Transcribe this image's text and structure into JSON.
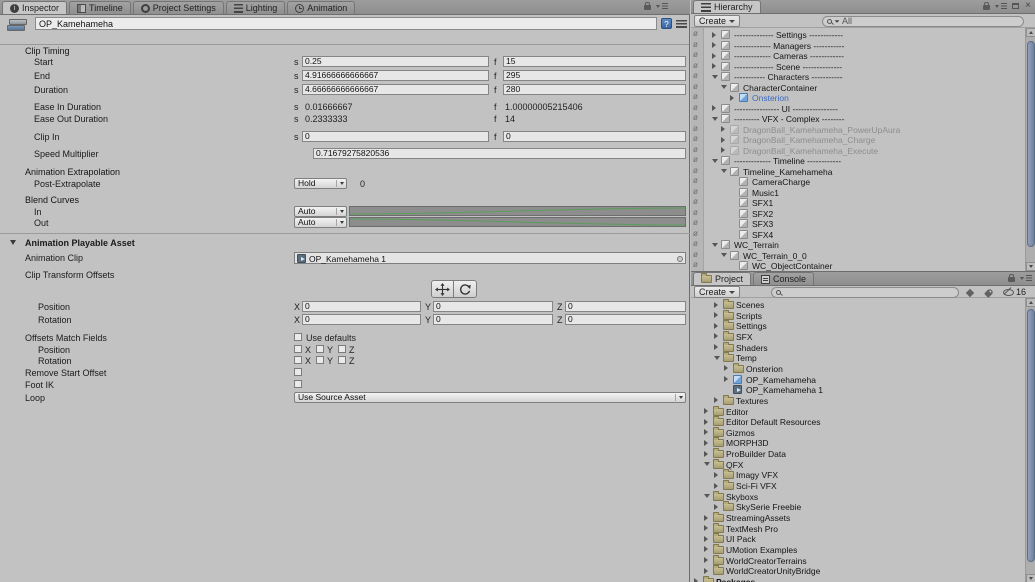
{
  "inspector": {
    "tabs": [
      {
        "label": "Inspector",
        "active": true
      },
      {
        "label": "Timeline",
        "active": false
      },
      {
        "label": "Project Settings",
        "active": false
      },
      {
        "label": "Lighting",
        "active": false
      },
      {
        "label": "Animation",
        "active": false
      }
    ],
    "header": {
      "name": "OP_Kamehameha"
    },
    "sections": {
      "clip_timing": {
        "title": "Clip Timing",
        "s_prefix": "s",
        "f_prefix": "f",
        "rows": [
          {
            "label": "Start",
            "s": "0.25",
            "f": "15",
            "boxed": true
          },
          {
            "label": "End",
            "s": "4.91666666666667",
            "f": "295",
            "boxed": true
          },
          {
            "label": "Duration",
            "s": "4.66666666666667",
            "f": "280",
            "boxed": true
          },
          {
            "label": "Ease In Duration",
            "s": "0.01666667",
            "f": "1.00000005215406",
            "boxed": false
          },
          {
            "label": "Ease Out Duration",
            "s": "0.2333333",
            "f": "14",
            "boxed": false
          },
          {
            "label": "Clip In",
            "s": "0",
            "f": "0",
            "boxed": true
          }
        ],
        "speed_multiplier_label": "Speed Multiplier",
        "speed_multiplier_value": "0.71679275820536"
      },
      "animation_extrapolation": {
        "title": "Animation Extrapolation",
        "post_extrapolate_label": "Post-Extrapolate",
        "post_extrapolate_value": "Hold",
        "post_extrapolate_extra": "0"
      },
      "blend_curves": {
        "title": "Blend Curves",
        "in_label": "In",
        "in_value": "Auto",
        "out_label": "Out",
        "out_value": "Auto",
        "curve_color": "#5a9e5a"
      },
      "playable_asset": {
        "title": "Animation Playable Asset",
        "animation_clip_label": "Animation Clip",
        "animation_clip_value": "OP_Kamehameha 1",
        "clip_transform_offsets_label": "Clip Transform Offsets",
        "position_label": "Position",
        "rotation_label": "Rotation",
        "axis_labels": {
          "x": "X",
          "y": "Y",
          "z": "Z"
        },
        "position": {
          "x": "0",
          "y": "0",
          "z": "0"
        },
        "rotation": {
          "x": "0",
          "y": "0",
          "z": "0"
        },
        "offsets_match_label": "Offsets Match Fields",
        "use_defaults_label": "Use defaults",
        "remove_start_offset_label": "Remove Start Offset",
        "foot_ik_label": "Foot IK",
        "loop_label": "Loop",
        "loop_value": "Use Source Asset"
      }
    }
  },
  "hierarchy": {
    "tab_label": "Hierarchy",
    "create_label": "Create",
    "search_filter": "All",
    "items": [
      {
        "level": 0,
        "arrow": "closed",
        "icon": "cube",
        "label": "-------------- Settings ------------"
      },
      {
        "level": 0,
        "arrow": "closed",
        "icon": "cube",
        "label": "------------- Managers -----------"
      },
      {
        "level": 0,
        "arrow": "closed",
        "icon": "cube",
        "label": "------------- Cameras ------------"
      },
      {
        "level": 0,
        "arrow": "closed",
        "icon": "cube",
        "label": "-------------- Scene --------------"
      },
      {
        "level": 0,
        "arrow": "open",
        "icon": "cube",
        "label": "----------- Characters -----------"
      },
      {
        "level": 1,
        "arrow": "open",
        "icon": "cube",
        "label": "CharacterContainer"
      },
      {
        "level": 2,
        "arrow": "closed",
        "icon": "cube-blue",
        "label": "Onsterion",
        "style": "blue"
      },
      {
        "level": 0,
        "arrow": "closed",
        "icon": "cube",
        "label": "---------------- UI ----------------"
      },
      {
        "level": 0,
        "arrow": "open",
        "icon": "cube",
        "label": "--------- VFX - Complex --------"
      },
      {
        "level": 1,
        "arrow": "closed",
        "icon": "cube-dim",
        "label": "DragonBall_Kamehameha_PowerUpAura",
        "style": "gray"
      },
      {
        "level": 1,
        "arrow": "closed",
        "icon": "cube-dim",
        "label": "DragonBall_Kamehameha_Charge",
        "style": "gray"
      },
      {
        "level": 1,
        "arrow": "closed",
        "icon": "cube-dim",
        "label": "DragonBall_Kamehameha_Execute",
        "style": "gray"
      },
      {
        "level": 0,
        "arrow": "open",
        "icon": "cube",
        "label": "------------- Timeline ------------"
      },
      {
        "level": 1,
        "arrow": "open",
        "icon": "cube",
        "label": "Timeline_Kamehameha"
      },
      {
        "level": 2,
        "arrow": null,
        "icon": "cube",
        "label": "CameraCharge"
      },
      {
        "level": 2,
        "arrow": null,
        "icon": "cube",
        "label": "Music1"
      },
      {
        "level": 2,
        "arrow": null,
        "icon": "cube",
        "label": "SFX1"
      },
      {
        "level": 2,
        "arrow": null,
        "icon": "cube",
        "label": "SFX2"
      },
      {
        "level": 2,
        "arrow": null,
        "icon": "cube",
        "label": "SFX3"
      },
      {
        "level": 2,
        "arrow": null,
        "icon": "cube",
        "label": "SFX4"
      },
      {
        "level": 0,
        "arrow": "open",
        "icon": "cube",
        "label": "WC_Terrain"
      },
      {
        "level": 1,
        "arrow": "open",
        "icon": "cube",
        "label": "WC_Terrain_0_0"
      },
      {
        "level": 2,
        "arrow": null,
        "icon": "cube",
        "label": "WC_ObjectContainer"
      }
    ]
  },
  "project": {
    "tab_label": "Project",
    "console_tab_label": "Console",
    "create_label": "Create",
    "hidden_count": "16",
    "items": [
      {
        "level": 2,
        "arrow": "closed",
        "icon": "folder",
        "label": "Scenes"
      },
      {
        "level": 2,
        "arrow": "closed",
        "icon": "folder",
        "label": "Scripts"
      },
      {
        "level": 2,
        "arrow": "closed",
        "icon": "folder",
        "label": "Settings"
      },
      {
        "level": 2,
        "arrow": "closed",
        "icon": "folder",
        "label": "SFX"
      },
      {
        "level": 2,
        "arrow": "closed",
        "icon": "folder",
        "label": "Shaders"
      },
      {
        "level": 2,
        "arrow": "open",
        "icon": "folder",
        "label": "Temp"
      },
      {
        "level": 3,
        "arrow": "closed",
        "icon": "folder",
        "label": "Onsterion"
      },
      {
        "level": 3,
        "arrow": "closed",
        "icon": "cube-blue",
        "label": "OP_Kamehameha"
      },
      {
        "level": 3,
        "arrow": null,
        "icon": "clip",
        "label": "OP_Kamehameha 1"
      },
      {
        "level": 2,
        "arrow": "closed",
        "icon": "folder",
        "label": "Textures"
      },
      {
        "level": 1,
        "arrow": "closed",
        "icon": "folder",
        "label": "Editor"
      },
      {
        "level": 1,
        "arrow": "closed",
        "icon": "folder",
        "label": "Editor Default Resources"
      },
      {
        "level": 1,
        "arrow": "closed",
        "icon": "folder",
        "label": "Gizmos"
      },
      {
        "level": 1,
        "arrow": "closed",
        "icon": "folder",
        "label": "MORPH3D"
      },
      {
        "level": 1,
        "arrow": "closed",
        "icon": "folder",
        "label": "ProBuilder Data"
      },
      {
        "level": 1,
        "arrow": "open",
        "icon": "folder",
        "label": "QFX"
      },
      {
        "level": 2,
        "arrow": "closed",
        "icon": "folder",
        "label": "Imagy VFX"
      },
      {
        "level": 2,
        "arrow": "closed",
        "icon": "folder",
        "label": "Sci-Fi VFX"
      },
      {
        "level": 1,
        "arrow": "open",
        "icon": "folder",
        "label": "Skyboxs"
      },
      {
        "level": 2,
        "arrow": "closed",
        "icon": "folder",
        "label": "SkySerie Freebie"
      },
      {
        "level": 1,
        "arrow": "closed",
        "icon": "folder",
        "label": "StreamingAssets"
      },
      {
        "level": 1,
        "arrow": "closed",
        "icon": "folder",
        "label": "TextMesh Pro"
      },
      {
        "level": 1,
        "arrow": "closed",
        "icon": "folder",
        "label": "UI Pack"
      },
      {
        "level": 1,
        "arrow": "closed",
        "icon": "folder",
        "label": "UMotion Examples"
      },
      {
        "level": 1,
        "arrow": "closed",
        "icon": "folder",
        "label": "WorldCreatorTerrains"
      },
      {
        "level": 1,
        "arrow": "closed",
        "icon": "folder",
        "label": "WorldCreatorUnityBridge"
      },
      {
        "level": 0,
        "arrow": "closed",
        "icon": "folder",
        "label": "Packages",
        "style": "bold"
      }
    ]
  }
}
